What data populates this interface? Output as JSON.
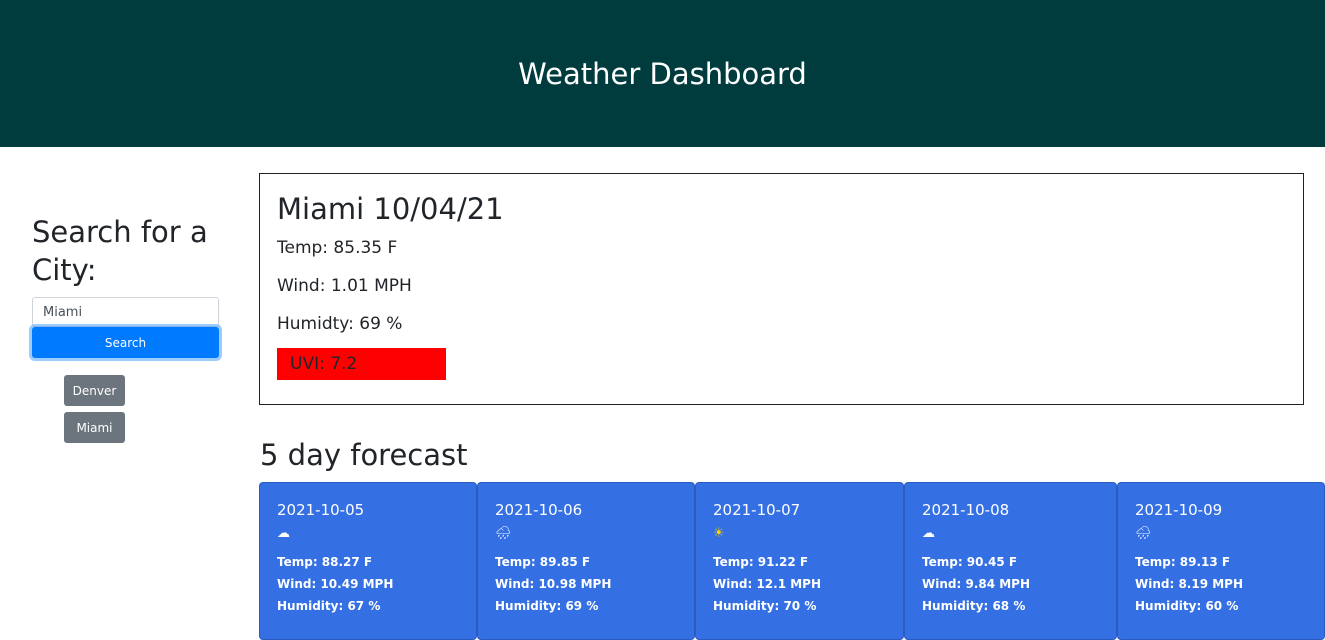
{
  "header": {
    "title": "Weather Dashboard"
  },
  "sidebar": {
    "heading": "Search for a City:",
    "search_value": "Miami",
    "search_button": "Search",
    "history": [
      "Denver",
      "Miami"
    ]
  },
  "current": {
    "title": "Miami 10/04/21",
    "temp": "Temp: 85.35 F",
    "wind": "Wind: 1.01 MPH",
    "humidity": "Humidty: 69 %",
    "uvi": "UVI: 7.2",
    "uvi_color": "#ff0000"
  },
  "forecast": {
    "title": "5 day forecast",
    "days": [
      {
        "date": "2021-10-05",
        "icon": "cloud-icon",
        "glyph": "☁",
        "temp": "Temp: 88.27 F",
        "wind": "Wind: 10.49 MPH",
        "humidity": "Humidity: 67 %"
      },
      {
        "date": "2021-10-06",
        "icon": "rain-cloud-icon",
        "glyph": "🌧",
        "temp": "Temp: 89.85 F",
        "wind": "Wind: 10.98 MPH",
        "humidity": "Humidity: 69 %"
      },
      {
        "date": "2021-10-07",
        "icon": "sun-icon",
        "glyph": "☀",
        "temp": "Temp: 91.22 F",
        "wind": "Wind: 12.1 MPH",
        "humidity": "Humidity: 70 %"
      },
      {
        "date": "2021-10-08",
        "icon": "cloud-icon",
        "glyph": "☁",
        "temp": "Temp: 90.45 F",
        "wind": "Wind: 9.84 MPH",
        "humidity": "Humidity: 68 %"
      },
      {
        "date": "2021-10-09",
        "icon": "rain-cloud-icon",
        "glyph": "🌧",
        "temp": "Temp: 89.13 F",
        "wind": "Wind: 8.19 MPH",
        "humidity": "Humidity: 60 %"
      }
    ]
  },
  "colors": {
    "header_bg": "#003b3e",
    "primary": "#007bff",
    "secondary": "#6c757d",
    "card_bg": "#3470e3"
  }
}
